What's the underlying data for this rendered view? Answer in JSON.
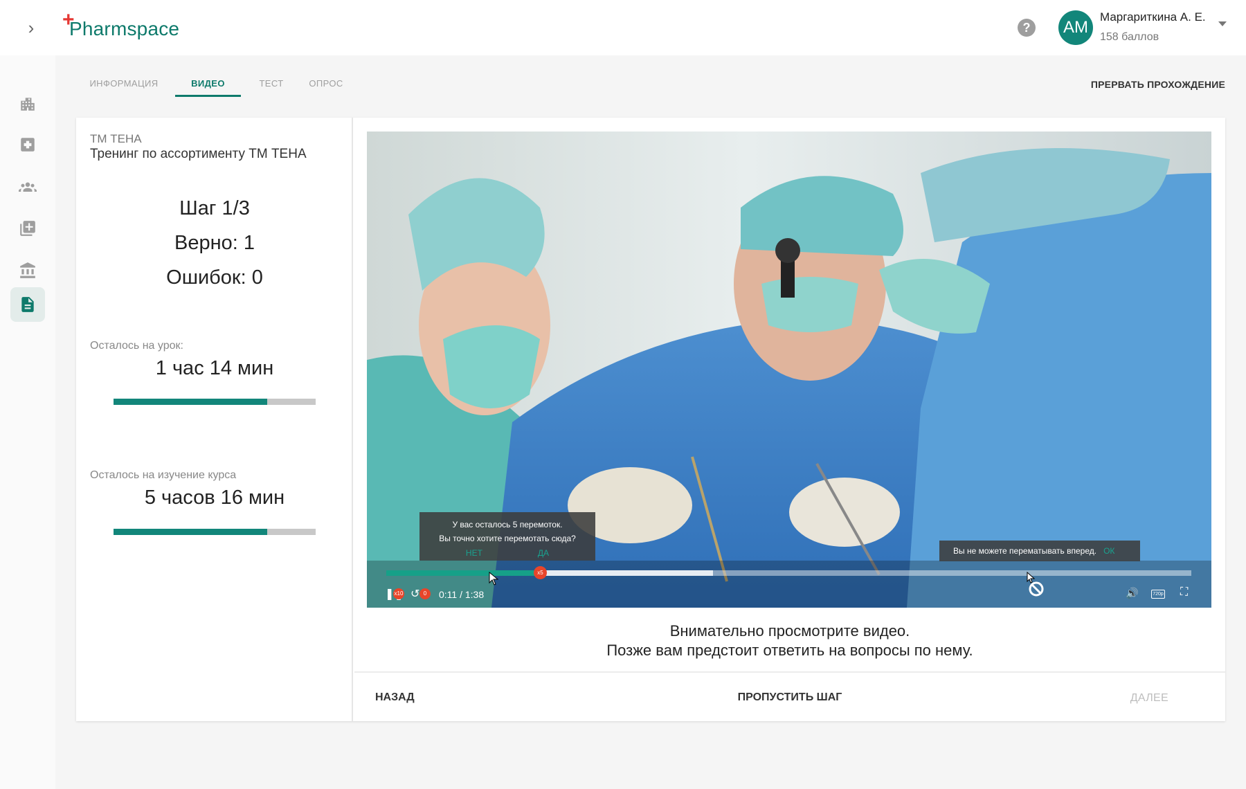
{
  "header": {
    "logo_text": "Pharmspace",
    "help_label": "?",
    "user": {
      "initials": "АМ",
      "name": "Маргариткина А. Е.",
      "points": "158 баллов"
    }
  },
  "sidebar": {
    "items": [
      {
        "icon": "buildings-icon"
      },
      {
        "icon": "medical-plus-icon"
      },
      {
        "icon": "people-icon"
      },
      {
        "icon": "library-add-icon"
      },
      {
        "icon": "bank-icon"
      },
      {
        "icon": "document-icon",
        "active": true
      }
    ]
  },
  "tabs": {
    "items": [
      {
        "label": "ИНФОРМАЦИЯ"
      },
      {
        "label": "ВИДЕО",
        "active": true
      },
      {
        "label": "ТЕСТ"
      },
      {
        "label": "ОПРОС"
      }
    ],
    "abort_label": "ПРЕРВАТЬ ПРОХОЖДЕНИЕ"
  },
  "lesson": {
    "brand": "ТМ ТЕНА",
    "title": "Тренинг по ассортименту ТМ ТЕНА",
    "step": "Шаг 1/3",
    "correct": "Верно: 1",
    "errors": "Ошибок: 0",
    "lesson_remaining_label": "Осталось на урок:",
    "lesson_remaining_value": "1 час 14 мин",
    "lesson_progress": 0.76,
    "course_remaining_label": "Осталось на изучение курса",
    "course_remaining_value": "5 часов 16 мин",
    "course_progress": 0.76
  },
  "video": {
    "rewind_prompt_line1": "У вас осталось 5 перемоток.",
    "rewind_prompt_line2": "Вы точно хотите перемотать сюда?",
    "rewind_no": "НЕТ",
    "rewind_yes": "ДА",
    "forward_blocked": "Вы не можете перематывать вперед.",
    "forward_ok": "ОК",
    "time": "0:11 / 1:38",
    "played_fraction": 0.184,
    "buffered_fraction": 0.406,
    "speed_badge": "x10",
    "rewind_badge": "0",
    "handle_badge": "x5",
    "quality": "720p"
  },
  "hint": {
    "line1": "Внимательно просмотрите видео.",
    "line2": "Позже вам предстоит ответить на вопросы по нему."
  },
  "footer": {
    "back_label": "НАЗАД",
    "skip_label": "ПРОПУСТИТЬ ШАГ",
    "next_label": "ДАЛЕЕ"
  },
  "colors": {
    "brand": "#0e7a6b",
    "accent_red": "#e53935",
    "progress_fill": "#12867a",
    "progress_track": "#c8c8c8"
  }
}
